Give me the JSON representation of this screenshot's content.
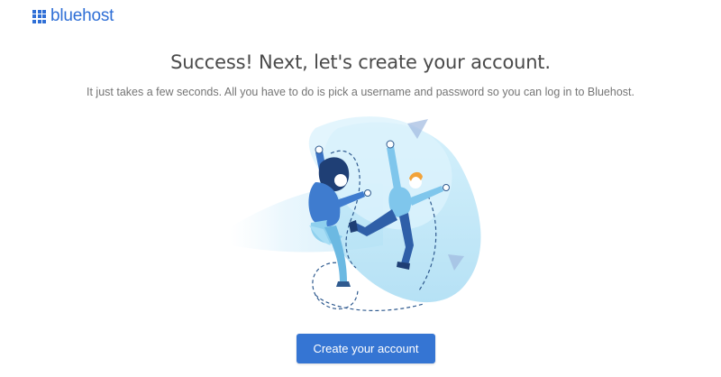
{
  "brand": {
    "name": "bluehost",
    "color": "#2f6fd6"
  },
  "main": {
    "headline": "Success! Next, let's create your account.",
    "subtext": "It just takes a few seconds. All you have to do is pick a username and password so you can log in to Bluehost.",
    "cta_label": "Create your account",
    "cta_color": "#3575d3"
  },
  "illustration": {
    "icon": "jumping-people-illustration"
  }
}
